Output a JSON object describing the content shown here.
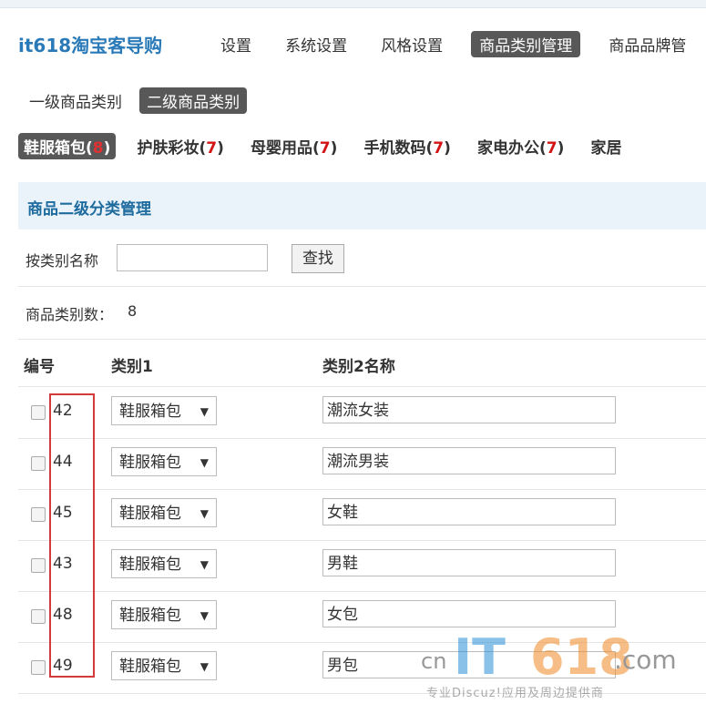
{
  "header": {
    "logo": "it618淘宝客导购",
    "nav": [
      "设置",
      "系统设置",
      "风格设置",
      "商品类别管理",
      "商品品牌管"
    ],
    "active_nav": 3
  },
  "level_tabs": [
    "一级商品类别",
    "二级商品类别"
  ],
  "active_level": 1,
  "categories": [
    {
      "name": "鞋服箱包",
      "count": "8"
    },
    {
      "name": "护肤彩妆",
      "count": "7"
    },
    {
      "name": "母婴用品",
      "count": "7"
    },
    {
      "name": "手机数码",
      "count": "7"
    },
    {
      "name": "家电办公",
      "count": "7"
    },
    {
      "name": "家居",
      "count": ""
    }
  ],
  "panel": {
    "title": "商品二级分类管理"
  },
  "search": {
    "label": "按类别名称",
    "value": "",
    "button": "查找"
  },
  "count": {
    "label": "商品类别数：",
    "value": "8"
  },
  "table": {
    "headers": [
      "编号",
      "类别1",
      "类别2名称"
    ],
    "rows": [
      {
        "id": "42",
        "cat1": "鞋服箱包",
        "cat2": "潮流女装"
      },
      {
        "id": "44",
        "cat1": "鞋服箱包",
        "cat2": "潮流男装"
      },
      {
        "id": "45",
        "cat1": "鞋服箱包",
        "cat2": "女鞋"
      },
      {
        "id": "43",
        "cat1": "鞋服箱包",
        "cat2": "男鞋"
      },
      {
        "id": "48",
        "cat1": "鞋服箱包",
        "cat2": "女包"
      },
      {
        "id": "49",
        "cat1": "鞋服箱包",
        "cat2": "男包"
      }
    ]
  },
  "watermark": {
    "cn": "cn",
    "it": "IT",
    "num": "618",
    "com": ".com",
    "slogan": "专业Discuz!应用及周边提供商"
  }
}
